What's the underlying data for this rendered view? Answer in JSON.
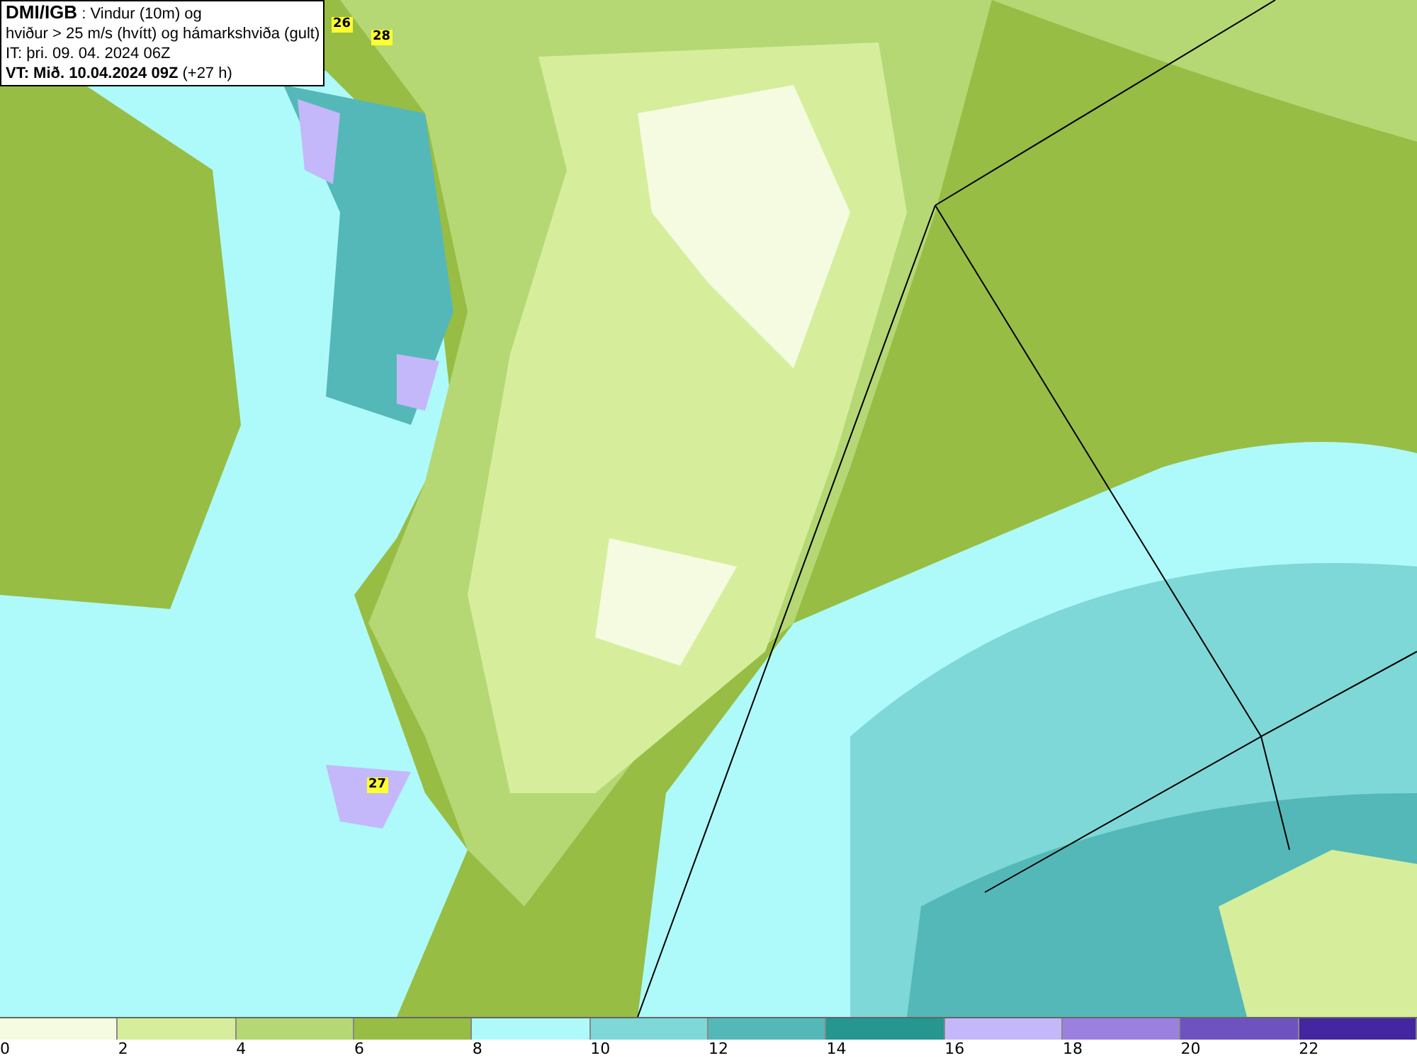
{
  "info_box": {
    "lines": [
      "**DMI/IGB** : Vindur (10m) og",
      "hviður > 25 m/s (hvítt) og hámarkshviða (gult)",
      "IT: þri. 09. 04. 2024 06Z",
      "**VT: Mið. 10.04.2024 09Z** (+27 h)"
    ]
  },
  "map": {
    "gust_markers": [
      {
        "value": "26"
      },
      {
        "value": "28"
      },
      {
        "value": "27"
      }
    ]
  },
  "legend": {
    "bins": [
      {
        "label": "0",
        "color": "#f5fbe0"
      },
      {
        "label": "2",
        "color": "#d6ee9c"
      },
      {
        "label": "4",
        "color": "#b5d874"
      },
      {
        "label": "6",
        "color": "#97bd45"
      },
      {
        "label": "8",
        "color": "#aefafa"
      },
      {
        "label": "10",
        "color": "#7fd8d8"
      },
      {
        "label": "12",
        "color": "#55b8b8"
      },
      {
        "label": "14",
        "color": "#259690"
      },
      {
        "label": "16",
        "color": "#c4b8fa"
      },
      {
        "label": "18",
        "color": "#9b80e0"
      },
      {
        "label": "20",
        "color": "#6e52c0"
      },
      {
        "label": "22",
        "color": "#4426a0"
      }
    ]
  }
}
